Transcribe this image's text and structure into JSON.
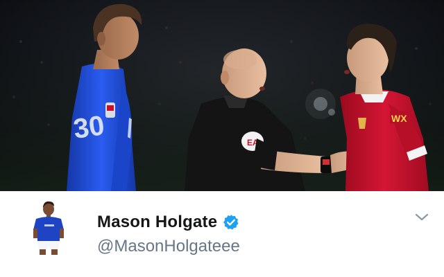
{
  "tweet": {
    "display_name": "Mason Holgate",
    "handle": "@MasonHolgateee",
    "verified": true,
    "avatar_icon": "user-avatar-icon",
    "menu_icon": "chevron-down-icon"
  },
  "photo": {
    "kit_badge": "FA",
    "sponsor": "WX",
    "referee_badge": "EA"
  },
  "colors": {
    "verified_blue": "#1da1f2",
    "name_text": "#14171a",
    "handle_text": "#657786",
    "chevron": "#8899a6",
    "blue_kit": "#1e4fd8",
    "red_kit": "#c8102e",
    "referee_kit": "#111111"
  }
}
